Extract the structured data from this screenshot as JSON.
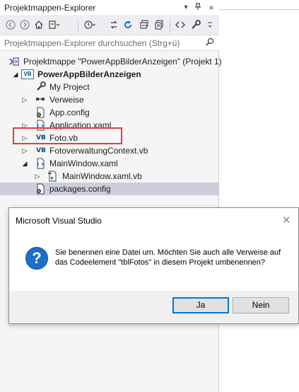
{
  "panel": {
    "title": "Projektmappen-Explorer",
    "title_buttons": {
      "dropdown": "▾",
      "pin": "⊣",
      "close": "×"
    }
  },
  "toolbar": {
    "icons": [
      "back-icon",
      "forward-icon",
      "home-icon",
      "switch-views-icon",
      "pending-changes-icon",
      "sync-icon",
      "refresh-icon",
      "collapse-all-icon",
      "show-all-files-icon",
      "view-code-icon",
      "properties-icon"
    ]
  },
  "search": {
    "placeholder": "Projektmappen-Explorer durchsuchen (Strg+ü)"
  },
  "tree": {
    "solution": "Projektmappe \"PowerAppBilderAnzeigen\" (Projekt 1)",
    "project": "PowerAppBilderAnzeigen",
    "items": [
      {
        "label": "My Project",
        "icon": "wrench-icon"
      },
      {
        "label": "Verweise",
        "icon": "references-icon"
      },
      {
        "label": "App.config",
        "icon": "config-file-icon"
      },
      {
        "label": "Application.xaml",
        "icon": "xaml-file-icon"
      },
      {
        "label": "Foto.vb",
        "icon": "vb-file-icon"
      },
      {
        "label": "FotoverwaltungContext.vb",
        "icon": "vb-file-icon"
      },
      {
        "label": "MainWindow.xaml",
        "icon": "xaml-file-icon"
      },
      {
        "label": "MainWindow.xaml.vb",
        "icon": "vb-file-icon"
      },
      {
        "label": "packages.config",
        "icon": "config-file-icon"
      }
    ],
    "vb_badge": "VB"
  },
  "dialog": {
    "title": "Microsoft Visual Studio",
    "icon_glyph": "?",
    "message": "Sie benennen eine Datei um. Möchten Sie auch alle Verweise auf das Codeelement \"tblFotos\" in diesem Projekt umbenennen?",
    "yes_label": "Ja",
    "no_label": "Nein",
    "close_glyph": "✕"
  },
  "colors": {
    "selection": "#cccedb",
    "highlight_box": "#d9433b",
    "accent": "#0078d7"
  }
}
